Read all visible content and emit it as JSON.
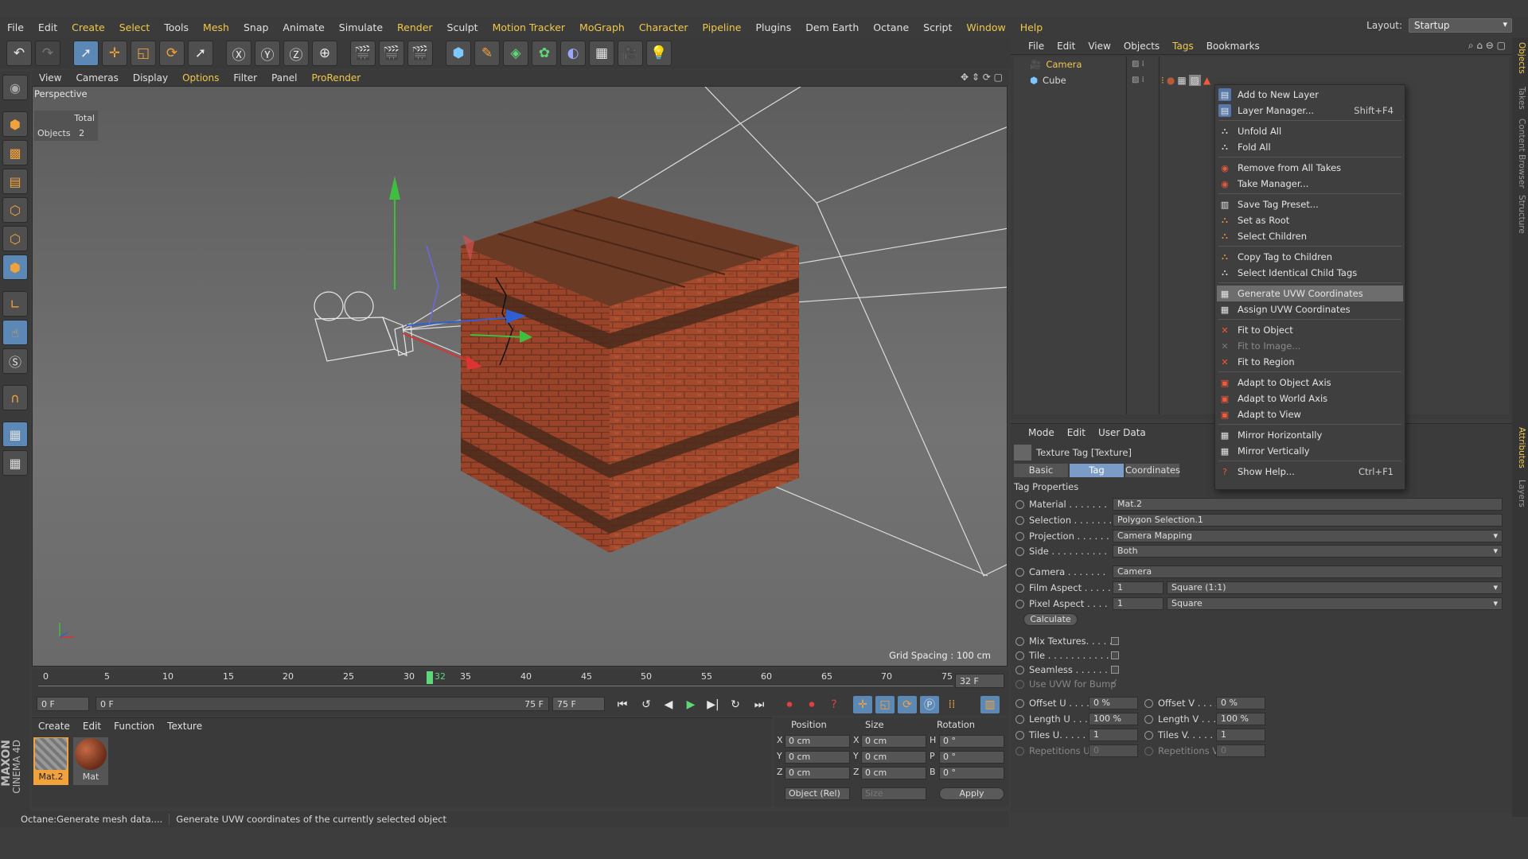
{
  "menubar": {
    "items": [
      "File",
      "Edit",
      "Create",
      "Select",
      "Tools",
      "Mesh",
      "Snap",
      "Animate",
      "Simulate",
      "Render",
      "Sculpt",
      "Motion Tracker",
      "MoGraph",
      "Character",
      "Pipeline",
      "Plugins",
      "Dem Earth",
      "Octane",
      "Script",
      "Window",
      "Help"
    ],
    "layout_label": "Layout:",
    "layout_value": "Startup"
  },
  "viewport": {
    "menu": [
      "View",
      "Cameras",
      "Display",
      "Options",
      "Filter",
      "Panel",
      "ProRender"
    ],
    "label": "Perspective",
    "hud_total": "Total",
    "hud_objects_label": "Objects",
    "hud_objects_value": "2",
    "grid_spacing": "Grid Spacing : 100 cm"
  },
  "timeline": {
    "ticks": [
      "0",
      "5",
      "10",
      "15",
      "20",
      "25",
      "30",
      "35",
      "40",
      "45",
      "50",
      "55",
      "60",
      "65",
      "70",
      "75"
    ],
    "current": "32",
    "frame_field": "32 F",
    "start": "0 F",
    "range_start": "0 F",
    "range_end": "75 F",
    "end": "75 F"
  },
  "material_manager": {
    "menu": [
      "Create",
      "Edit",
      "Function",
      "Texture"
    ],
    "materials": [
      {
        "name": "Mat.2"
      },
      {
        "name": "Mat"
      }
    ]
  },
  "coordinates": {
    "headers": [
      "Position",
      "Size",
      "Rotation"
    ],
    "rows": [
      {
        "axis": "X",
        "pos": "0 cm",
        "sizeaxis": "X",
        "size": "0 cm",
        "rotaxis": "H",
        "rot": "0 °"
      },
      {
        "axis": "Y",
        "pos": "0 cm",
        "sizeaxis": "Y",
        "size": "0 cm",
        "rotaxis": "P",
        "rot": "0 °"
      },
      {
        "axis": "Z",
        "pos": "0 cm",
        "sizeaxis": "Z",
        "size": "0 cm",
        "rotaxis": "B",
        "rot": "0 °"
      }
    ],
    "mode": "Object (Rel)",
    "size_mode": "Size",
    "apply": "Apply"
  },
  "status": {
    "left": "Octane:Generate mesh data....",
    "right": "Generate UVW coordinates of the currently selected object"
  },
  "object_manager": {
    "menu": [
      "File",
      "Edit",
      "View",
      "Objects",
      "Tags",
      "Bookmarks"
    ],
    "objects": [
      "Camera",
      "Cube"
    ]
  },
  "side_tabs": [
    "Objects",
    "Takes",
    "Content Browser",
    "Structure",
    "Attributes",
    "Layers"
  ],
  "attributes": {
    "menu": [
      "Mode",
      "Edit",
      "User Data"
    ],
    "title": "Texture Tag [Texture]",
    "tabs": [
      "Basic",
      "Tag",
      "Coordinates"
    ],
    "section": "Tag Properties",
    "material_label": "Material . . . . . . .",
    "material": "Mat.2",
    "selection_label": "Selection . . . . . . .",
    "selection": "Polygon Selection.1",
    "projection_label": "Projection . . . . . .",
    "projection": "Camera Mapping",
    "side_label": "Side . . . . . . . . . .",
    "side": "Both",
    "camera_label": "Camera . . . . . . .",
    "camera": "Camera",
    "film_aspect_label": "Film Aspect . . . . .",
    "film_aspect": "1",
    "film_aspect_preset": "Square (1:1)",
    "pixel_aspect_label": "Pixel Aspect . . . .",
    "pixel_aspect": "1",
    "pixel_aspect_preset": "Square",
    "calculate": "Calculate",
    "mix_label": "Mix Textures. . . . . .",
    "tile_label": "Tile . . . . . . . . . . .",
    "seamless_label": "Seamless . . . . . . .",
    "uvwbump_label": "Use UVW for Bump",
    "offset_u_label": "Offset U . . . . .",
    "offset_u": "0 %",
    "offset_v_label": "Offset V . . . . .",
    "offset_v": "0 %",
    "length_u_label": "Length U . . . .",
    "length_u": "100 %",
    "length_v_label": "Length V . . . .",
    "length_v": "100 %",
    "tiles_u_label": "Tiles U. . . . . . .",
    "tiles_u": "1",
    "tiles_v_label": "Tiles V. . . . . . .",
    "tiles_v": "1",
    "rep_u_label": "Repetitions U",
    "rep_u": "0",
    "rep_v_label": "Repetitions V",
    "rep_v": "0"
  },
  "context_menu": {
    "items": [
      {
        "label": "Add to New Layer",
        "shortcut": ""
      },
      {
        "label": "Layer Manager...",
        "shortcut": "Shift+F4"
      },
      {
        "label": "Unfold All",
        "shortcut": ""
      },
      {
        "label": "Fold All",
        "shortcut": ""
      },
      {
        "label": "Remove from All Takes",
        "shortcut": ""
      },
      {
        "label": "Take Manager...",
        "shortcut": ""
      },
      {
        "label": "Save Tag Preset...",
        "shortcut": ""
      },
      {
        "label": "Set as Root",
        "shortcut": ""
      },
      {
        "label": "Select Children",
        "shortcut": ""
      },
      {
        "label": "Copy Tag to Children",
        "shortcut": ""
      },
      {
        "label": "Select Identical Child Tags",
        "shortcut": ""
      },
      {
        "label": "Generate UVW Coordinates",
        "shortcut": ""
      },
      {
        "label": "Assign UVW Coordinates",
        "shortcut": ""
      },
      {
        "label": "Fit to Object",
        "shortcut": ""
      },
      {
        "label": "Fit to Image...",
        "shortcut": ""
      },
      {
        "label": "Fit to Region",
        "shortcut": ""
      },
      {
        "label": "Adapt to Object Axis",
        "shortcut": ""
      },
      {
        "label": "Adapt to World Axis",
        "shortcut": ""
      },
      {
        "label": "Adapt to View",
        "shortcut": ""
      },
      {
        "label": "Mirror Horizontally",
        "shortcut": ""
      },
      {
        "label": "Mirror Vertically",
        "shortcut": ""
      },
      {
        "label": "Show Help...",
        "shortcut": "Ctrl+F1"
      }
    ],
    "highlighted": "Generate UVW Coordinates",
    "disabled": "Fit to Image..."
  },
  "colors": {
    "accent": "#f2c84b",
    "selection_blue": "#7b9cc6",
    "brick": "#a8502f"
  },
  "brand": {
    "line1": "MAXON",
    "line2": "CINEMA 4D"
  }
}
